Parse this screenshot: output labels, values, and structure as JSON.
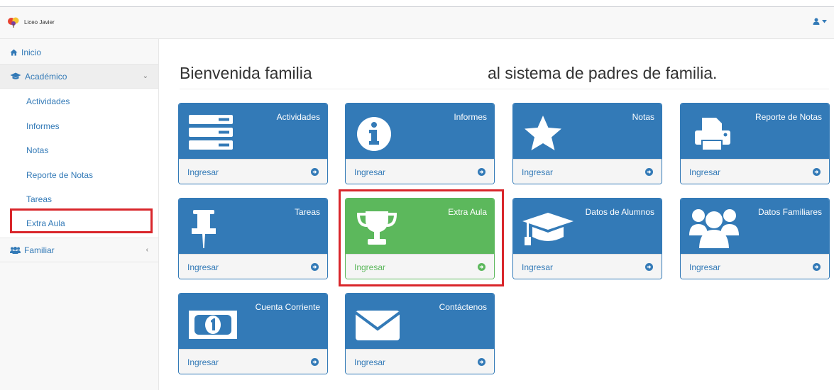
{
  "header": {
    "brand": "Liceo Javier",
    "user_icon": "user-icon"
  },
  "sidebar": {
    "inicio": "Inicio",
    "academico": "Académico",
    "sub_items": [
      "Actividades",
      "Informes",
      "Notas",
      "Reporte de Notas",
      "Tareas",
      "Extra Aula"
    ],
    "familiar": "Familiar"
  },
  "welcome": {
    "left": "Bienvenida familia",
    "right": "al sistema de padres de familia."
  },
  "cards": [
    {
      "title": "Actividades",
      "footer": "Ingresar",
      "icon": "list-icon"
    },
    {
      "title": "Informes",
      "footer": "Ingresar",
      "icon": "info-icon"
    },
    {
      "title": "Notas",
      "footer": "Ingresar",
      "icon": "star-icon"
    },
    {
      "title": "Reporte de Notas",
      "footer": "Ingresar",
      "icon": "print-icon"
    },
    {
      "title": "Tareas",
      "footer": "Ingresar",
      "icon": "pushpin-icon"
    },
    {
      "title": "Extra Aula",
      "footer": "Ingresar",
      "icon": "trophy-icon"
    },
    {
      "title": "Datos de Alumnos",
      "footer": "Ingresar",
      "icon": "graduation-cap-icon"
    },
    {
      "title": "Datos Familiares",
      "footer": "Ingresar",
      "icon": "users-icon"
    },
    {
      "title": "Cuenta Corriente",
      "footer": "Ingresar",
      "icon": "money-icon"
    },
    {
      "title": "Contáctenos",
      "footer": "Ingresar",
      "icon": "envelope-icon"
    }
  ],
  "colors": {
    "primary": "#337ab7",
    "success": "#5cb85c",
    "highlight": "#d9262b"
  }
}
